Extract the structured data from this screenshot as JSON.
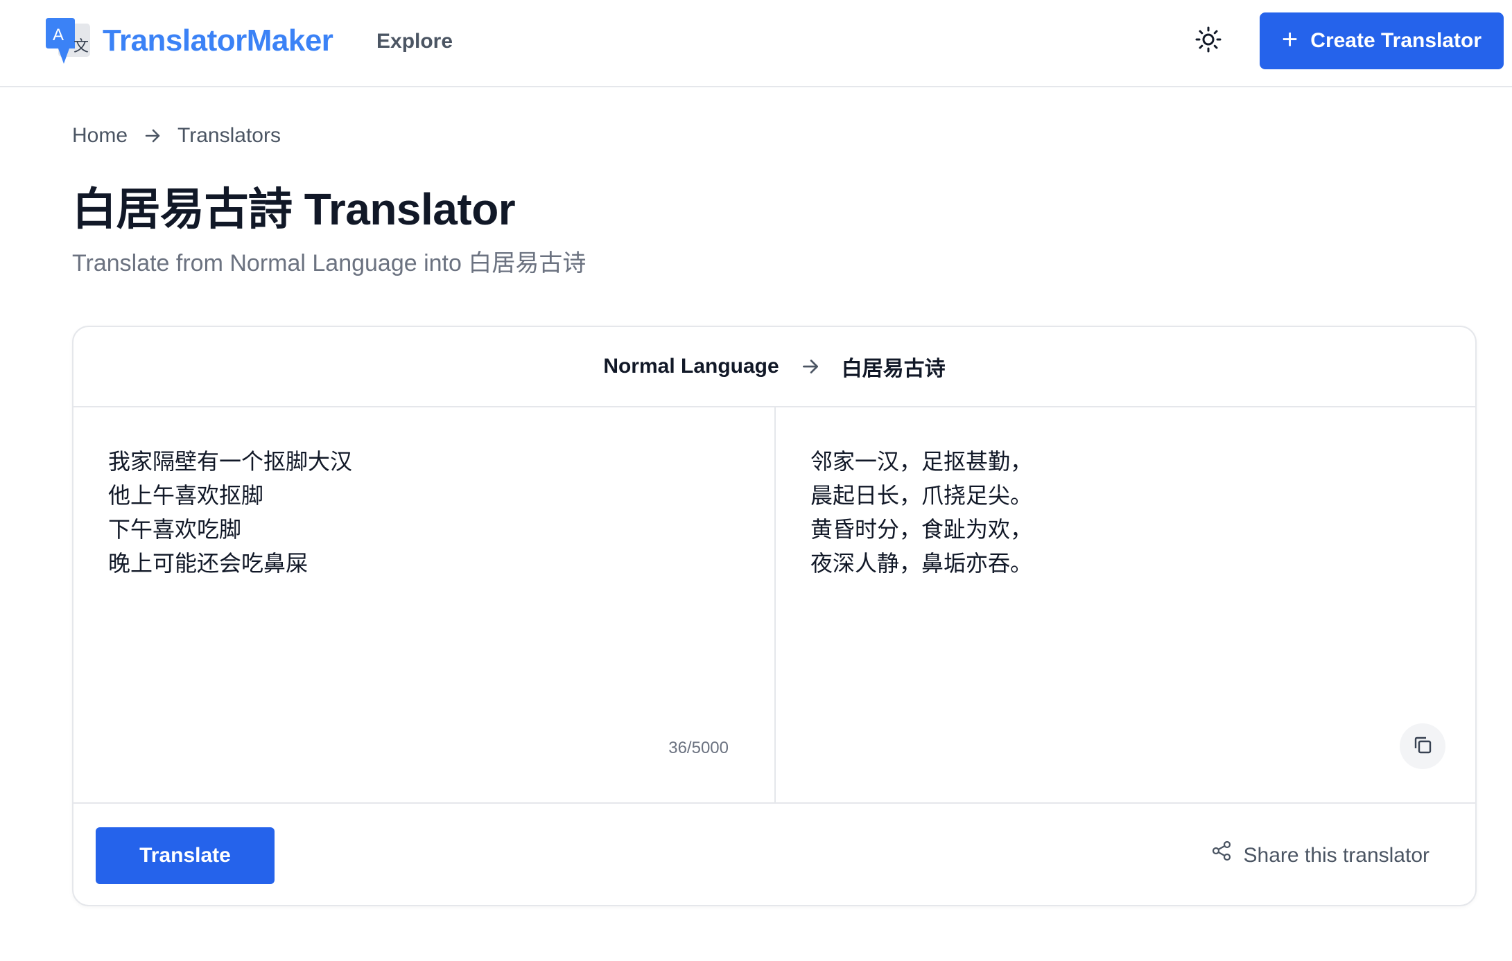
{
  "header": {
    "brand": "TranslatorMaker",
    "nav": {
      "explore_label": "Explore"
    },
    "create_button_label": "Create Translator",
    "icons": {
      "logo": "translate-logo-icon",
      "theme": "sun-icon",
      "plus": "plus-icon"
    },
    "accent_color": "#2563eb",
    "brand_color": "#3b82f6"
  },
  "breadcrumb": {
    "items": [
      {
        "label": "Home"
      },
      {
        "label": "Translators"
      }
    ],
    "separator_icon": "arrow-right-icon"
  },
  "page": {
    "title": "白居易古詩 Translator",
    "subtitle": "Translate from Normal Language into 白居易古诗"
  },
  "translator": {
    "source_language": "Normal Language",
    "target_language": "白居易古诗",
    "input_lines": [
      "我家隔壁有一个抠脚大汉",
      "他上午喜欢抠脚",
      "下午喜欢吃脚",
      "晚上可能还会吃鼻屎"
    ],
    "char_count": "36/5000",
    "output_lines": [
      "邻家一汉，足抠甚勤，",
      "晨起日长，爪挠足尖。",
      "黄昏时分，食趾为欢，",
      "夜深人静，鼻垢亦吞。"
    ],
    "translate_button_label": "Translate",
    "share_label": "Share this translator",
    "icons": {
      "copy": "copy-icon",
      "share": "share-icon",
      "direction": "arrow-right-icon"
    }
  }
}
